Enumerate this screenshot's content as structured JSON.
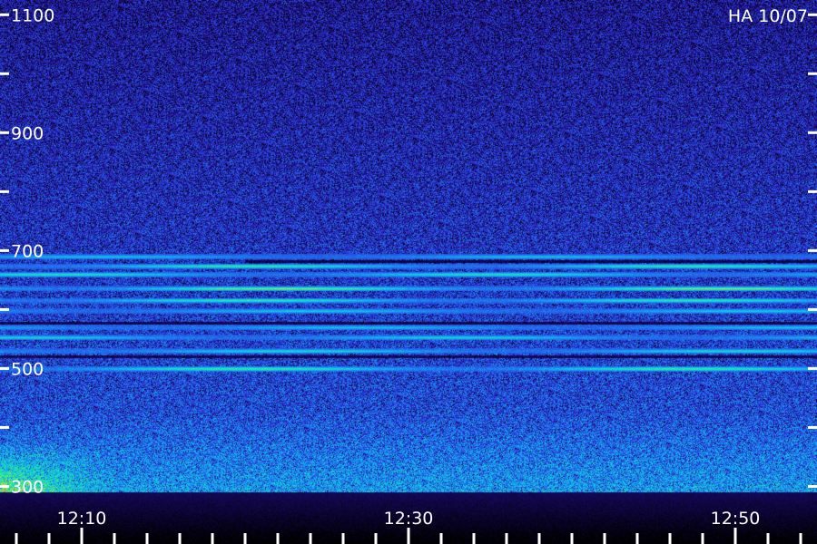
{
  "chart_data": {
    "type": "heatmap",
    "title": "",
    "annotation": "HA 10/07",
    "xlabel": "",
    "ylabel": "",
    "x_ticks": [
      "12:10",
      "12:30",
      "12:50"
    ],
    "x_range": [
      "12:05",
      "12:55"
    ],
    "x_minor_tick_step_min": 2,
    "y_ticks": [
      300,
      500,
      700,
      900,
      1100
    ],
    "y_range": [
      290,
      1125
    ],
    "y_minor_ticks": [
      300,
      400,
      500,
      600,
      700,
      800,
      900,
      1000,
      1100
    ],
    "colormap": [
      "#000000",
      "#1a0a6e",
      "#2c2cd0",
      "#1e78f0",
      "#10c8e8",
      "#20f090",
      "#e8e020",
      "#ff3010"
    ],
    "background_color": "#140a50",
    "emission_lines": [
      {
        "y": 674,
        "t_start": "12:05",
        "t_end": "12:55",
        "intensity": 0.85
      },
      {
        "y": 660,
        "t_start": "12:05",
        "t_end": "12:55",
        "intensity": 0.75
      },
      {
        "y": 636,
        "t_start": "12:05",
        "t_end": "12:55",
        "intensity": 1.0
      },
      {
        "y": 616,
        "t_start": "12:05",
        "t_end": "12:55",
        "intensity": 0.8
      },
      {
        "y": 598,
        "t_start": "12:05",
        "t_end": "12:55",
        "intensity": 0.55
      },
      {
        "y": 570,
        "t_start": "12:05",
        "t_end": "12:55",
        "intensity": 0.5
      },
      {
        "y": 553,
        "t_start": "12:05",
        "t_end": "12:55",
        "intensity": 0.6
      },
      {
        "y": 530,
        "t_start": "12:05",
        "t_end": "12:55",
        "intensity": 0.65
      },
      {
        "y": 500,
        "t_start": "12:05",
        "t_end": "12:55",
        "intensity": 0.9
      },
      {
        "y": 690,
        "t_start": "12:05",
        "t_end": "12:55",
        "intensity": 0.5
      }
    ],
    "dark_gaps": [
      {
        "y": 682,
        "t_start": "12:20",
        "t_end": "12:55"
      },
      {
        "y": 520,
        "t_start": "12:05",
        "t_end": "12:55"
      },
      {
        "y": 578,
        "t_start": "12:05",
        "t_end": "12:55"
      }
    ]
  }
}
